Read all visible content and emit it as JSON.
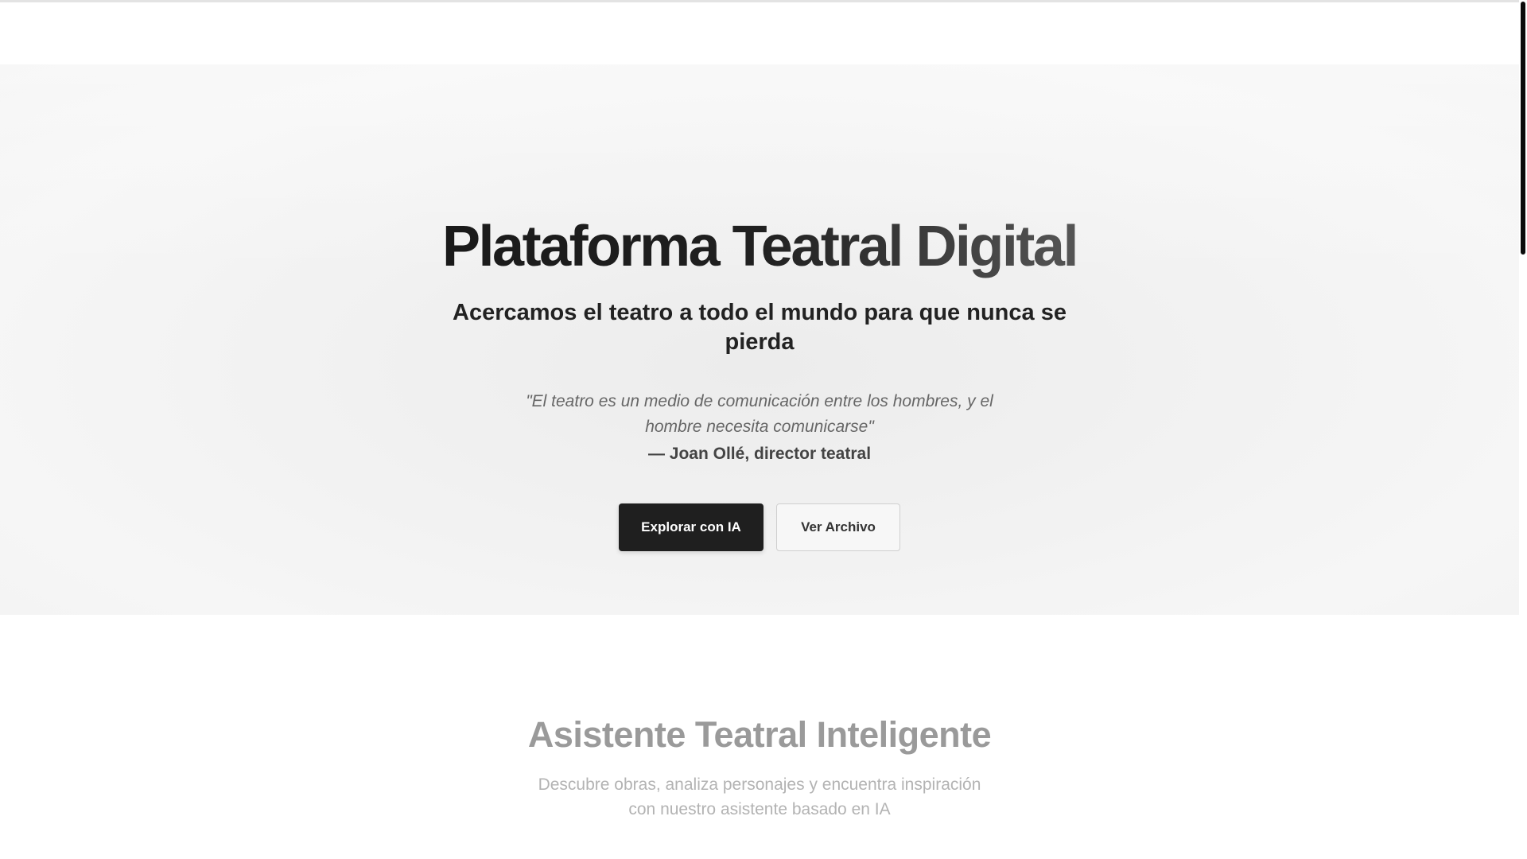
{
  "hero": {
    "title": "Plataforma Teatral Digital",
    "subtitle": "Acercamos el teatro a todo el mundo para que nunca se pierda",
    "quote": "\"El teatro es un medio de comunicación entre los hombres, y el hombre necesita comunicarse\"",
    "author": "— Joan Ollé, director teatral",
    "primary_button": "Explorar con IA",
    "secondary_button": "Ver Archivo"
  },
  "assistant": {
    "title": "Asistente Teatral Inteligente",
    "description": "Descubre obras, analiza personajes y encuentra inspiración con nuestro asistente basado en IA"
  },
  "colors": {
    "primary_button_bg": "#1f1f1f",
    "title_text": "#1a1a1a",
    "muted_title": "#9a9a9a",
    "muted_text": "#b3b3b3"
  }
}
